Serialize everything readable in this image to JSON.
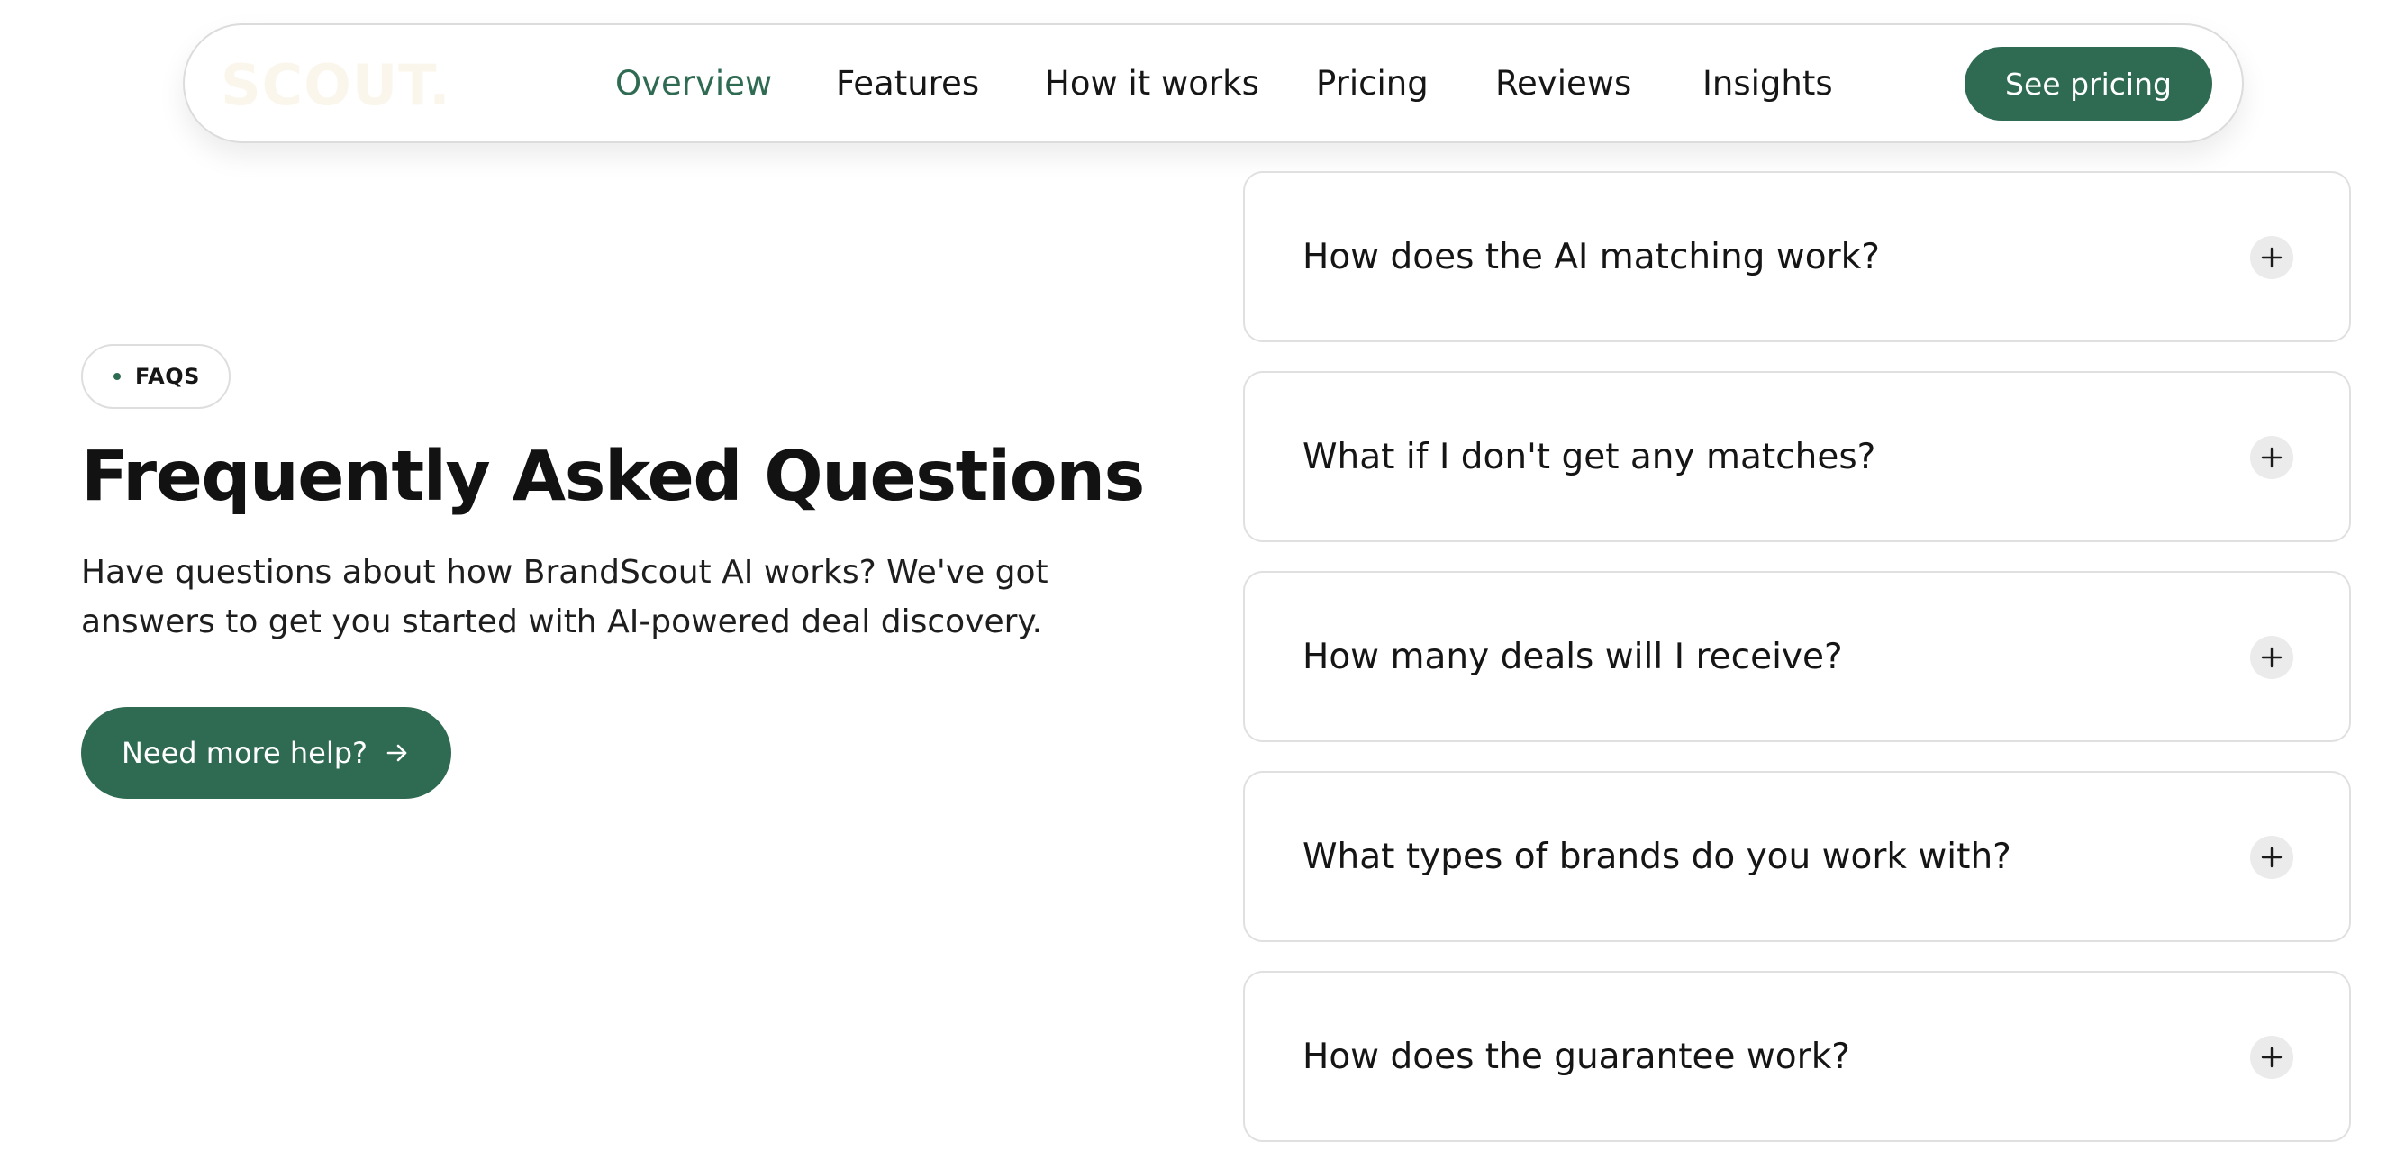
{
  "nav": {
    "logo": "SCOUT.",
    "links": [
      {
        "label": "Overview",
        "active": true
      },
      {
        "label": "Features",
        "active": false
      },
      {
        "label": "How it works",
        "active": false
      },
      {
        "label": "Pricing",
        "active": false
      },
      {
        "label": "Reviews",
        "active": false
      },
      {
        "label": "Insights",
        "active": false
      }
    ],
    "cta_label": "See pricing"
  },
  "faq_intro": {
    "badge": "FAQS",
    "title": "Frequently Asked Questions",
    "description": "Have questions about how BrandScout AI works? We've got answers to get you started with AI-powered deal discovery.",
    "help_button": "Need more help?",
    "help_icon": "arrow-right-icon"
  },
  "faqs": [
    {
      "question": "How does the AI matching work?",
      "icon": "plus-icon",
      "expanded": false
    },
    {
      "question": "What if I don't get any matches?",
      "icon": "plus-icon",
      "expanded": false
    },
    {
      "question": "How many deals will I receive?",
      "icon": "plus-icon",
      "expanded": false
    },
    {
      "question": "What types of brands do you work with?",
      "icon": "plus-icon",
      "expanded": false
    },
    {
      "question": "How does the guarantee work?",
      "icon": "plus-icon",
      "expanded": false
    }
  ],
  "colors": {
    "accent": "#2f6b52",
    "text": "#121212",
    "border": "#e0e0e0",
    "logo": "#fbf6ec"
  }
}
